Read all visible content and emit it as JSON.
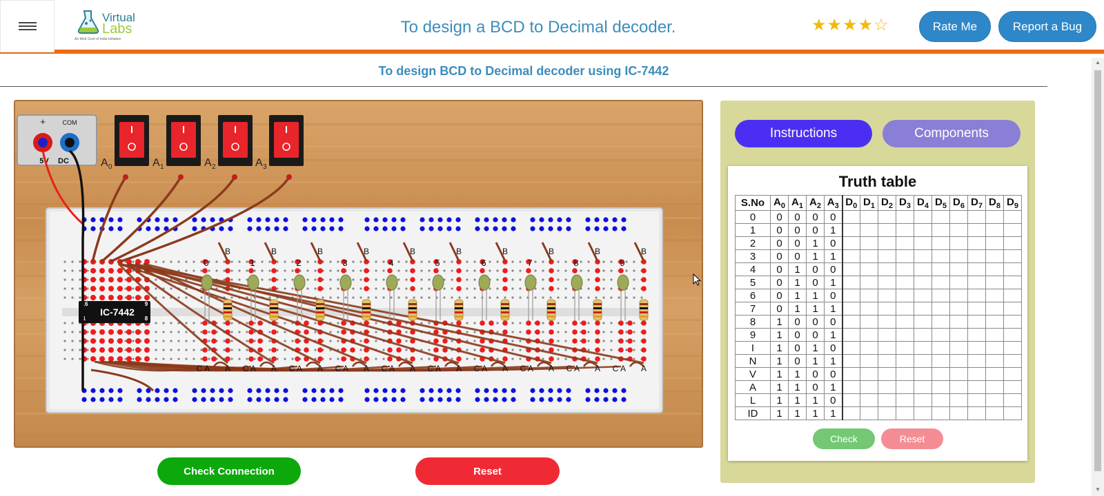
{
  "header": {
    "logo_line1": "Virtual",
    "logo_line2": "Labs",
    "logo_tagline": "An MoE Govt of India Initiative",
    "title": "To design a BCD to Decimal decoder.",
    "rating": 4,
    "rating_max": 5,
    "rate_button": "Rate Me",
    "bug_button": "Report a Bug"
  },
  "subtitle": "To design BCD to Decimal decoder using IC-7442",
  "board": {
    "power_plus": "+",
    "power_com": "COM",
    "power_label_5v": "5V",
    "power_label_dc": "DC",
    "switch_labels": [
      "A",
      "A",
      "A",
      "A"
    ],
    "switch_subs": [
      "0",
      "1",
      "2",
      "3"
    ],
    "ic_label": "IC-7442",
    "ic_pins": [
      "16",
      "9",
      "1",
      "8"
    ],
    "led_numbers": [
      "0",
      "1",
      "2",
      "3",
      "4",
      "5",
      "6",
      "7",
      "8",
      "9"
    ],
    "led_b_label": "B",
    "led_c_label": "C",
    "led_a_label": "A",
    "colors": {
      "wood": "#cf9658",
      "wire": "#8b3a1c",
      "hole_red": "#ee1c1c",
      "hole_blue": "#1010dd",
      "switch_red": "#e8252a"
    }
  },
  "buttons": {
    "check_connection": "Check Connection",
    "reset": "Reset"
  },
  "panel": {
    "tab_instructions": "Instructions",
    "tab_components": "Components",
    "truth_table_title": "Truth table",
    "headers": [
      "S.No",
      "A",
      "A",
      "A",
      "A",
      "D",
      "D",
      "D",
      "D",
      "D",
      "D",
      "D",
      "D",
      "D",
      "D"
    ],
    "header_subs": [
      "",
      "0",
      "1",
      "2",
      "3",
      "0",
      "1",
      "2",
      "3",
      "4",
      "5",
      "6",
      "7",
      "8",
      "9"
    ],
    "rows": [
      [
        "0",
        "0",
        "0",
        "0",
        "0"
      ],
      [
        "1",
        "0",
        "0",
        "0",
        "1"
      ],
      [
        "2",
        "0",
        "0",
        "1",
        "0"
      ],
      [
        "3",
        "0",
        "0",
        "1",
        "1"
      ],
      [
        "4",
        "0",
        "1",
        "0",
        "0"
      ],
      [
        "5",
        "0",
        "1",
        "0",
        "1"
      ],
      [
        "6",
        "0",
        "1",
        "1",
        "0"
      ],
      [
        "7",
        "0",
        "1",
        "1",
        "1"
      ],
      [
        "8",
        "1",
        "0",
        "0",
        "0"
      ],
      [
        "9",
        "1",
        "0",
        "0",
        "1"
      ],
      [
        "I",
        "1",
        "0",
        "1",
        "0"
      ],
      [
        "N",
        "1",
        "0",
        "1",
        "1"
      ],
      [
        "V",
        "1",
        "1",
        "0",
        "0"
      ],
      [
        "A",
        "1",
        "1",
        "0",
        "1"
      ],
      [
        "L",
        "1",
        "1",
        "1",
        "0"
      ],
      [
        "ID",
        "1",
        "1",
        "1",
        "1"
      ]
    ],
    "check_button": "Check",
    "reset_button": "Reset"
  }
}
